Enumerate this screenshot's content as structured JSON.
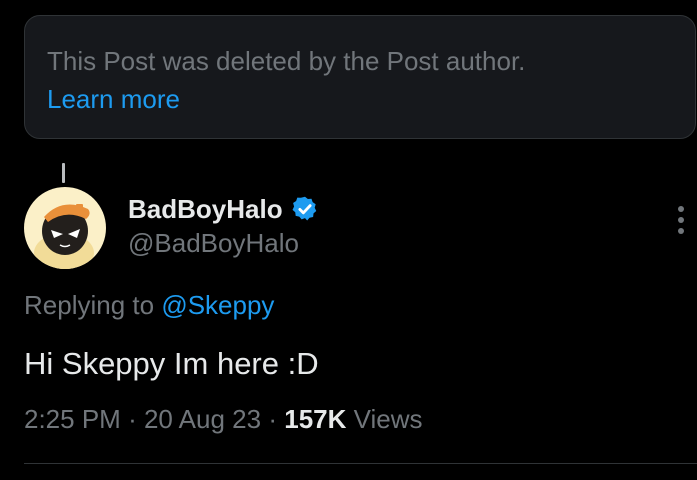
{
  "deleted_notice": {
    "text": "This Post was deleted by the Post author.",
    "link_label": "Learn more"
  },
  "author": {
    "display_name": "BadBoyHalo",
    "handle": "@BadBoyHalo",
    "verified_icon": "verified-badge-icon",
    "avatar_icon": "avatar-image"
  },
  "reply": {
    "prefix": "Replying to",
    "mention": "@Skeppy"
  },
  "tweet": {
    "text": "Hi Skeppy Im here :D",
    "time": "2:25 PM",
    "date": "20 Aug 23",
    "separator": "·",
    "views_count": "157K",
    "views_label": "Views"
  },
  "more_icon": "more-vertical-icon",
  "colors": {
    "background": "#000000",
    "notice_background": "#16181c",
    "primary_text": "#e7e9ea",
    "secondary_text": "#71767b",
    "link": "#1d9bf0",
    "verified": "#1d9bf0",
    "border": "#2f3336"
  }
}
